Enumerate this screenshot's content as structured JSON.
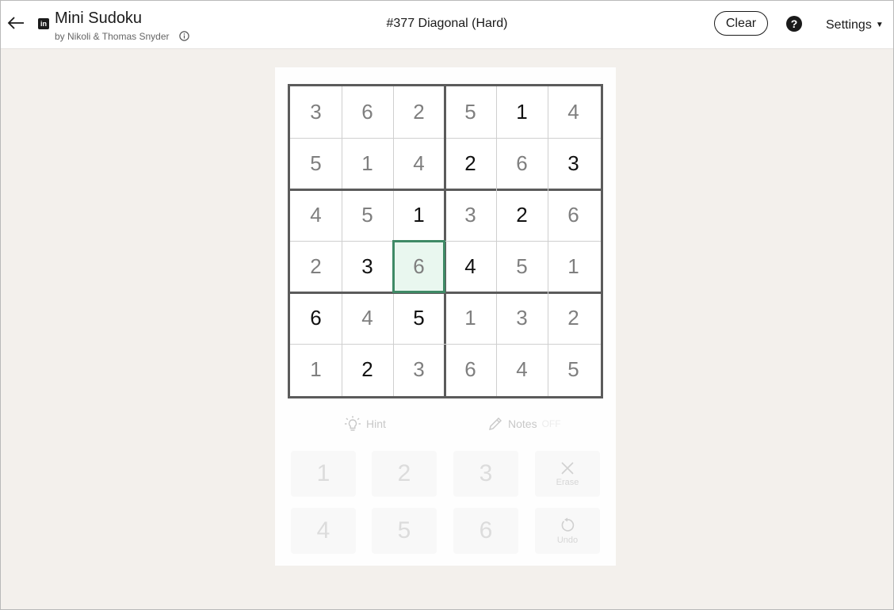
{
  "header": {
    "app_title": "Mini Sudoku",
    "byline": "by Nikoli & Thomas Snyder",
    "puzzle_title": "#377 Diagonal (Hard)",
    "clear_label": "Clear",
    "settings_label": "Settings",
    "logo_text": "in"
  },
  "icons": [
    "back-arrow-icon",
    "linkedin-logo-icon",
    "info-icon",
    "help-icon",
    "caret-down-icon",
    "lightbulb-icon",
    "pencil-icon",
    "close-icon",
    "undo-icon"
  ],
  "colors": {
    "selected_cell_border": "#3f8a66",
    "selected_cell_fill": "#e9f7ef",
    "page_background": "#f3f0ec"
  },
  "board": {
    "size": 6,
    "box_rows": 2,
    "box_cols": 3,
    "selected": {
      "row": 4,
      "col": 3
    },
    "cells": [
      [
        {
          "v": "3",
          "t": "filled"
        },
        {
          "v": "6",
          "t": "filled"
        },
        {
          "v": "2",
          "t": "filled"
        },
        {
          "v": "5",
          "t": "filled"
        },
        {
          "v": "1",
          "t": "given"
        },
        {
          "v": "4",
          "t": "filled"
        }
      ],
      [
        {
          "v": "5",
          "t": "filled"
        },
        {
          "v": "1",
          "t": "filled"
        },
        {
          "v": "4",
          "t": "filled"
        },
        {
          "v": "2",
          "t": "given"
        },
        {
          "v": "6",
          "t": "filled"
        },
        {
          "v": "3",
          "t": "given"
        }
      ],
      [
        {
          "v": "4",
          "t": "filled"
        },
        {
          "v": "5",
          "t": "filled"
        },
        {
          "v": "1",
          "t": "given"
        },
        {
          "v": "3",
          "t": "filled"
        },
        {
          "v": "2",
          "t": "given"
        },
        {
          "v": "6",
          "t": "filled"
        }
      ],
      [
        {
          "v": "2",
          "t": "filled"
        },
        {
          "v": "3",
          "t": "given"
        },
        {
          "v": "6",
          "t": "filled"
        },
        {
          "v": "4",
          "t": "given"
        },
        {
          "v": "5",
          "t": "filled"
        },
        {
          "v": "1",
          "t": "filled"
        }
      ],
      [
        {
          "v": "6",
          "t": "given"
        },
        {
          "v": "4",
          "t": "filled"
        },
        {
          "v": "5",
          "t": "given"
        },
        {
          "v": "1",
          "t": "filled"
        },
        {
          "v": "3",
          "t": "filled"
        },
        {
          "v": "2",
          "t": "filled"
        }
      ],
      [
        {
          "v": "1",
          "t": "filled"
        },
        {
          "v": "2",
          "t": "given"
        },
        {
          "v": "3",
          "t": "filled"
        },
        {
          "v": "6",
          "t": "filled"
        },
        {
          "v": "4",
          "t": "filled"
        },
        {
          "v": "5",
          "t": "filled"
        }
      ]
    ]
  },
  "controls": {
    "hint_label": "Hint",
    "notes_label": "Notes",
    "notes_state": "OFF",
    "keypad": [
      "1",
      "2",
      "3",
      "4",
      "5",
      "6"
    ],
    "erase_label": "Erase",
    "undo_label": "Undo"
  }
}
